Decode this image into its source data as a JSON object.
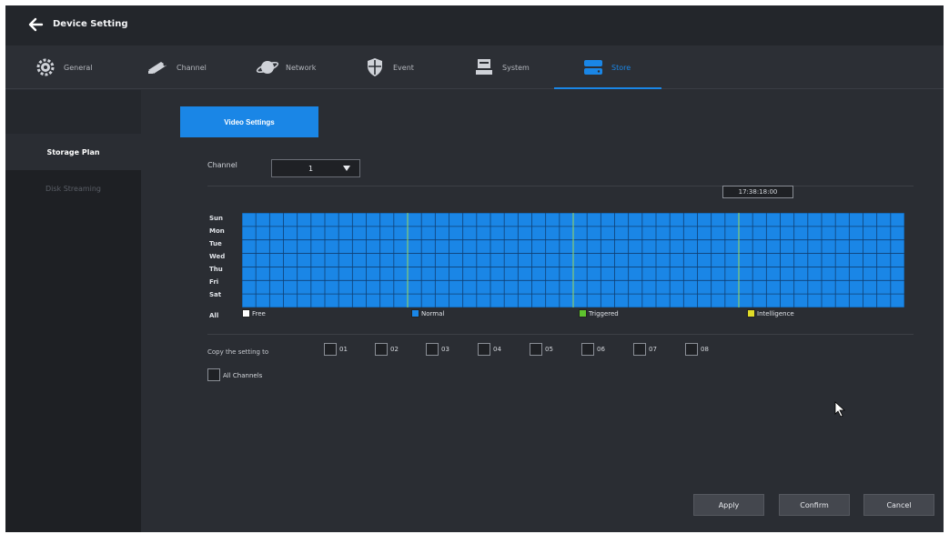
{
  "window": {
    "title": "Device Setting"
  },
  "tabs": [
    {
      "label": "General",
      "icon": "gear-icon"
    },
    {
      "label": "Channel",
      "icon": "camera-icon"
    },
    {
      "label": "Network",
      "icon": "planet-icon"
    },
    {
      "label": "Event",
      "icon": "shield-icon"
    },
    {
      "label": "System",
      "icon": "system-icon"
    },
    {
      "label": "Store",
      "icon": "storage-icon",
      "active": true
    }
  ],
  "sidebar": {
    "items": [
      {
        "label": "Storage Plan",
        "active": true
      },
      {
        "label": "Disk Streaming",
        "active": false
      }
    ]
  },
  "main": {
    "video_button": "Video Settings",
    "channel_label": "Channel",
    "channel_value": "1",
    "time_display": "17:38:18:00",
    "days": [
      "Sun",
      "Mon",
      "Tue",
      "Wed",
      "Thu",
      "Fri",
      "Sat"
    ],
    "all_label": "All",
    "schedule": {
      "hours": 24,
      "slots_per_hour": 2,
      "mode": "Normal"
    },
    "legend": [
      {
        "label": "Free",
        "color": "#ffffff"
      },
      {
        "label": "Normal",
        "color": "#1a86e6"
      },
      {
        "label": "Triggered",
        "color": "#5ec22e"
      },
      {
        "label": "Intelligence",
        "color": "#e0dc28"
      }
    ],
    "copy_label": "Copy the setting to",
    "copy_channels": [
      "01",
      "02",
      "03",
      "04",
      "05",
      "06",
      "07",
      "08"
    ],
    "all_channels_label": "All Channels"
  },
  "buttons": {
    "apply": "Apply",
    "confirm": "Confirm",
    "cancel": "Cancel"
  },
  "colors": {
    "accent": "#1a86e6",
    "background": "#2a2d33",
    "sidebar": "#1e2024"
  }
}
